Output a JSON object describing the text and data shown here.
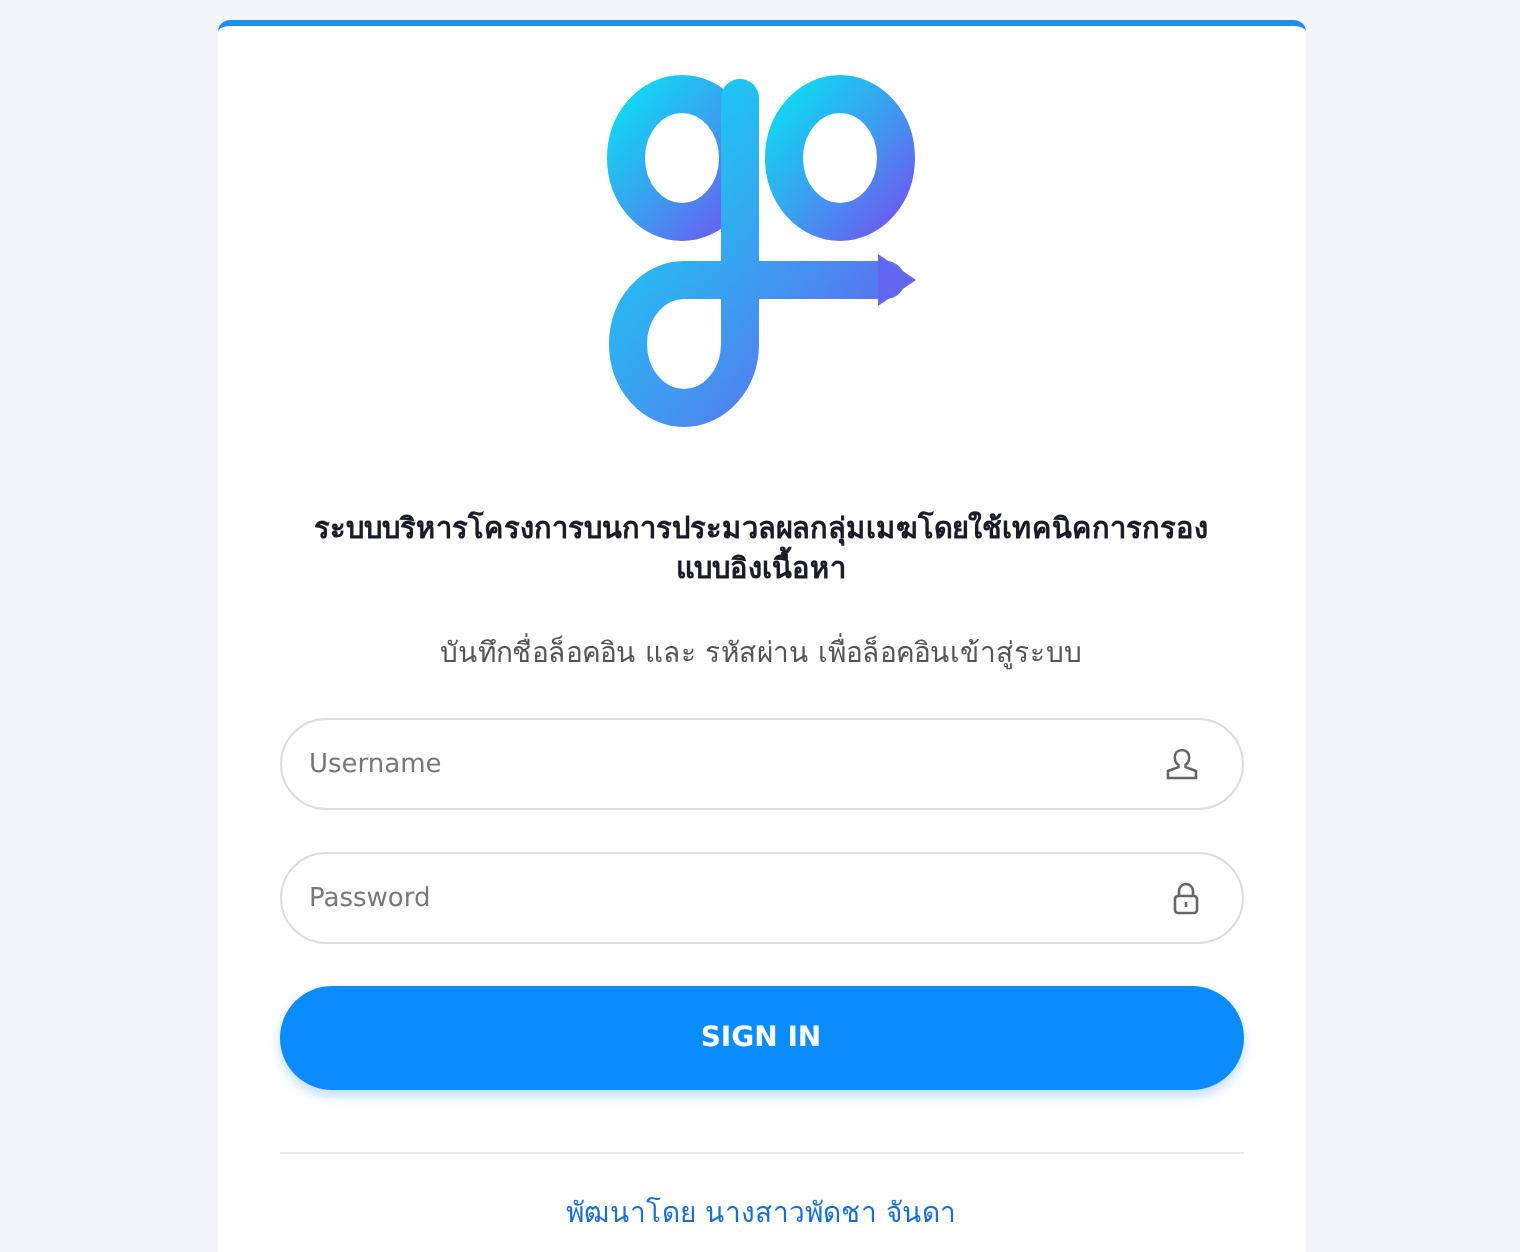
{
  "title": "ระบบบริหารโครงการบนการประมวลผลกลุ่มเมฆโดยใช้เทคนิคการกรองแบบอิงเนื้อหา",
  "subtitle": "บันทึกชื่อล็อคอิน และ รหัสผ่าน เพื่อล็อคอินเข้าสู่ระบบ",
  "fields": [
    {
      "kind": "username",
      "placeholder": "Username"
    },
    {
      "kind": "password",
      "placeholder": "Password"
    }
  ],
  "button": "SIGN IN",
  "footer": "พัฒนาโดย นางสาวพัดชา จันดา"
}
